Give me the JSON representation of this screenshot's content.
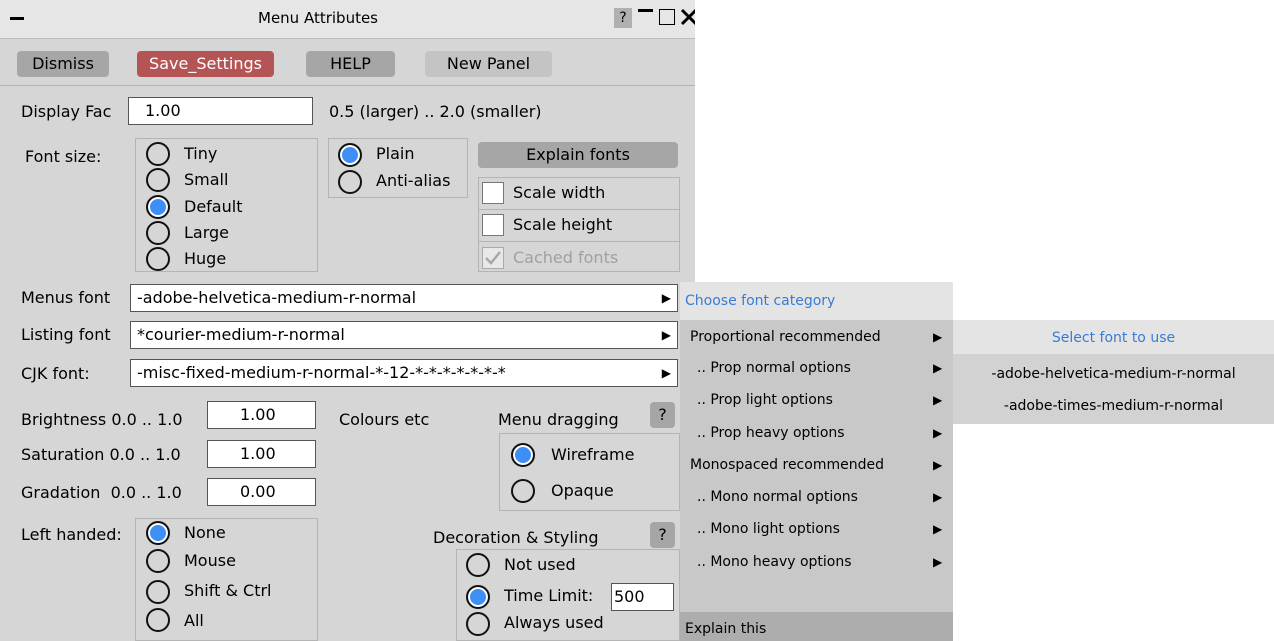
{
  "window": {
    "title": "Menu Attributes",
    "help_glyph": "?",
    "controls": [
      "minimize-icon",
      "maximize-icon",
      "close-icon"
    ],
    "menu_glyph": "menu-dash-icon"
  },
  "toolbar": {
    "dismiss": "Dismiss",
    "save": "Save_Settings",
    "help": "HELP",
    "new_panel": "New Panel"
  },
  "display": {
    "label": "Display Fac",
    "value": "1.00",
    "hint": "0.5 (larger) .. 2.0 (smaller)"
  },
  "font_size": {
    "label": "Font size:",
    "options": [
      "Tiny",
      "Small",
      "Default",
      "Large",
      "Huge"
    ],
    "selected": "Default"
  },
  "render": {
    "options": [
      "Plain",
      "Anti-alias"
    ],
    "selected": "Plain"
  },
  "explain_fonts": "Explain fonts",
  "scale": {
    "width": "Scale width",
    "height": "Scale height",
    "cached": "Cached fonts"
  },
  "fonts": {
    "menus_label": "Menus font",
    "menus_value": "-adobe-helvetica-medium-r-normal",
    "listing_label": "Listing font",
    "listing_value": "*courier-medium-r-normal",
    "cjk_label": "CJK font:",
    "cjk_value": "-misc-fixed-medium-r-normal-*-12-*-*-*-*-*-*-*"
  },
  "colours": {
    "brightness_label": "Brightness 0.0 .. 1.0",
    "brightness_value": "1.00",
    "saturation_label": "Saturation 0.0 .. 1.0",
    "saturation_value": "1.00",
    "gradation_label": "Gradation  0.0 .. 1.0",
    "gradation_value": "0.00",
    "colours_label": "Colours etc"
  },
  "dragging": {
    "label": "Menu dragging",
    "help": "?",
    "options": [
      "Wireframe",
      "Opaque"
    ],
    "selected": "Wireframe"
  },
  "left_handed": {
    "label": "Left handed:",
    "options": [
      "None",
      "Mouse",
      "Shift & Ctrl",
      "All"
    ],
    "selected": "None"
  },
  "decoration": {
    "label": "Decoration & Styling",
    "help": "?",
    "options": [
      "Not used",
      "Time Limit:",
      "Always used"
    ],
    "selected": "Time Limit:",
    "time_limit": "500"
  },
  "category_menu": {
    "title": "Choose font category",
    "items": [
      "Proportional recommended",
      ".. Prop normal options",
      ".. Prop light options",
      ".. Prop heavy options",
      "Monospaced recommended",
      ".. Mono normal options",
      ".. Mono light options",
      ".. Mono heavy options"
    ],
    "explain": "Explain this"
  },
  "font_menu": {
    "title": "Select font to use",
    "items": [
      "-adobe-helvetica-medium-r-normal",
      "-adobe-times-medium-r-normal"
    ]
  },
  "colors": {
    "panel_bg": "#d6d6d6",
    "save_button": "#b45454",
    "radio_selected": "#3d8ef5",
    "menu_title": "#3a7bd5"
  }
}
